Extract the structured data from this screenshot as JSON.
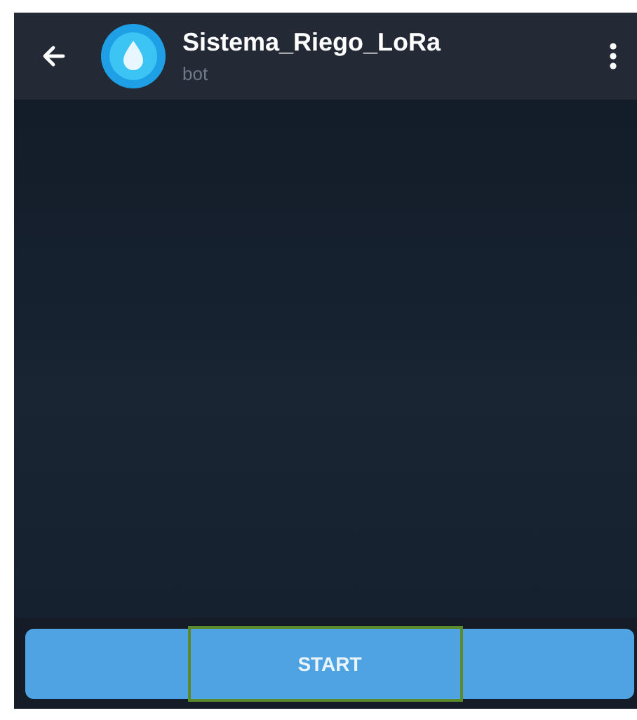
{
  "header": {
    "title": "Sistema_Riego_LoRa",
    "subtitle": "bot"
  },
  "start_button": {
    "label": "START",
    "highlighted": true
  }
}
